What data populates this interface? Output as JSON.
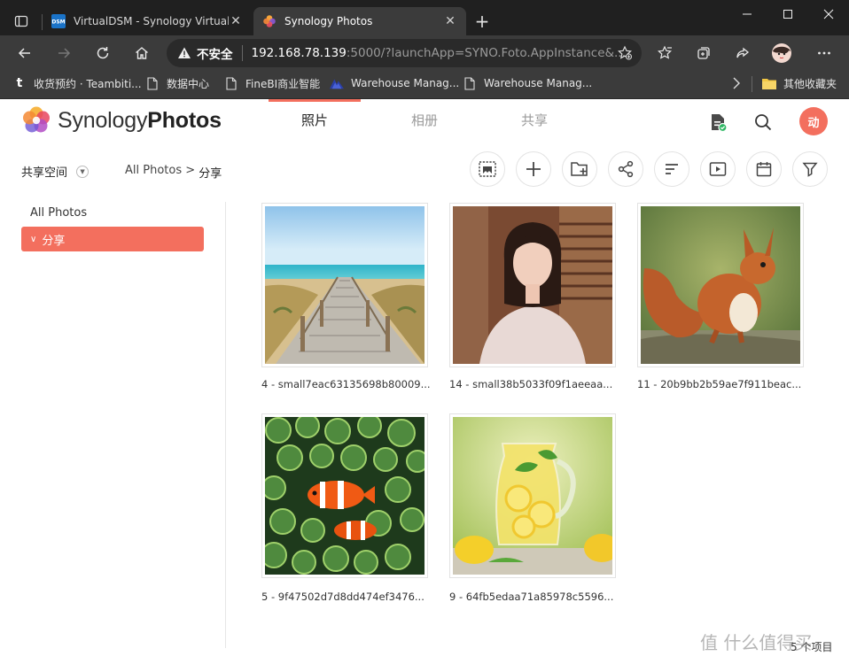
{
  "browser": {
    "tabs": [
      {
        "title": "VirtualDSM - Synology VirtualDSM",
        "favicon": "dsm-icon",
        "favicon_text": "DSM",
        "active": false
      },
      {
        "title": "Synology Photos",
        "favicon": "synology-photos-icon",
        "active": true
      }
    ],
    "address": {
      "warning": "不安全",
      "host": "192.168.78.139",
      "rest": ":5000/?launchApp=SYNO.Foto.AppInstance&..."
    },
    "bookmarks": [
      {
        "label": "收货预约 · Teambiti...",
        "icon": "t-icon",
        "icon_text": "t"
      },
      {
        "label": "数据中心",
        "icon": "page-icon"
      },
      {
        "label": "FineBI商业智能",
        "icon": "page-icon"
      },
      {
        "label": "Warehouse Manag...",
        "icon": "mountain-icon"
      },
      {
        "label": "Warehouse Manag...",
        "icon": "page-icon"
      }
    ],
    "other_bookmarks": "其他收藏夹"
  },
  "app": {
    "logo_word_light": "Synology",
    "logo_word_bold": "Photos",
    "nav_tabs": [
      {
        "label": "照片",
        "active": true
      },
      {
        "label": "相册",
        "active": false
      },
      {
        "label": "共享",
        "active": false
      }
    ],
    "avatar_text": "动",
    "space_label": "共享空间",
    "breadcrumb": {
      "root": "All Photos",
      "sep": " > ",
      "current": "分享"
    },
    "sidebar": {
      "all": "All Photos",
      "active": "分享"
    },
    "photos": [
      {
        "caption": "4 - small7eac63135698b80009...",
        "subject": "beach-boardwalk"
      },
      {
        "caption": "14 - small38b5033f09f1aeeaa...",
        "subject": "portrait-woman"
      },
      {
        "caption": "11 - 20b9bb2b59ae7f911beac...",
        "subject": "red-squirrel"
      },
      {
        "caption": "5 - 9f47502d7d8dd474ef3476...",
        "subject": "clownfish-anemone"
      },
      {
        "caption": "9 - 64fb5edaa71a85978c5596...",
        "subject": "lemonade-pitcher"
      }
    ],
    "count_text": "5 个项目",
    "watermark": "值 什么值得买"
  },
  "colors": {
    "accent": "#f36f5e",
    "chrome_dark": "#202020",
    "chrome_mid": "#3b3b3b"
  }
}
